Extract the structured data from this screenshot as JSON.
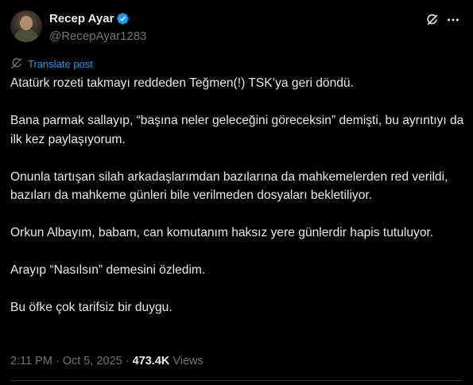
{
  "author": {
    "name": "Recep Ayar",
    "handle": "@RecepAyar1283",
    "verified": true,
    "verified_color": "#1d9bf0"
  },
  "actions": {
    "grok_icon": "grok-icon",
    "more_icon": "more-options-icon"
  },
  "translate_label": "Translate post",
  "paragraphs": [
    "Atatürk rozeti takmayı reddeden Teğmen(!) TSK’ya geri döndü.",
    "Bana parmak sallayıp, “başına neler geleceğini göreceksin” demişti, bu ayrıntıyı da ilk kez paylaşıyorum.",
    "Onunla tartışan silah arkadaşlarımdan bazılarına da mahkemelerden red verildi, bazıları da mahkeme günleri bile verilmeden dosyaları bekletiliyor.",
    "Orkun Albayım, babam, can komutanım haksız yere günlerdir hapis tutuluyor.",
    "Arayıp “Nasılsın” demesini özledim.",
    "Bu öfke çok tarifsiz bir duygu."
  ],
  "meta": {
    "time": "2:11 PM",
    "separator": "·",
    "date": "Oct 5, 2025",
    "views_count": "473.4K",
    "views_label": "Views"
  },
  "colors": {
    "background": "#000000",
    "text": "#e7e9ea",
    "secondary": "#71767b",
    "accent": "#1d9bf0"
  }
}
